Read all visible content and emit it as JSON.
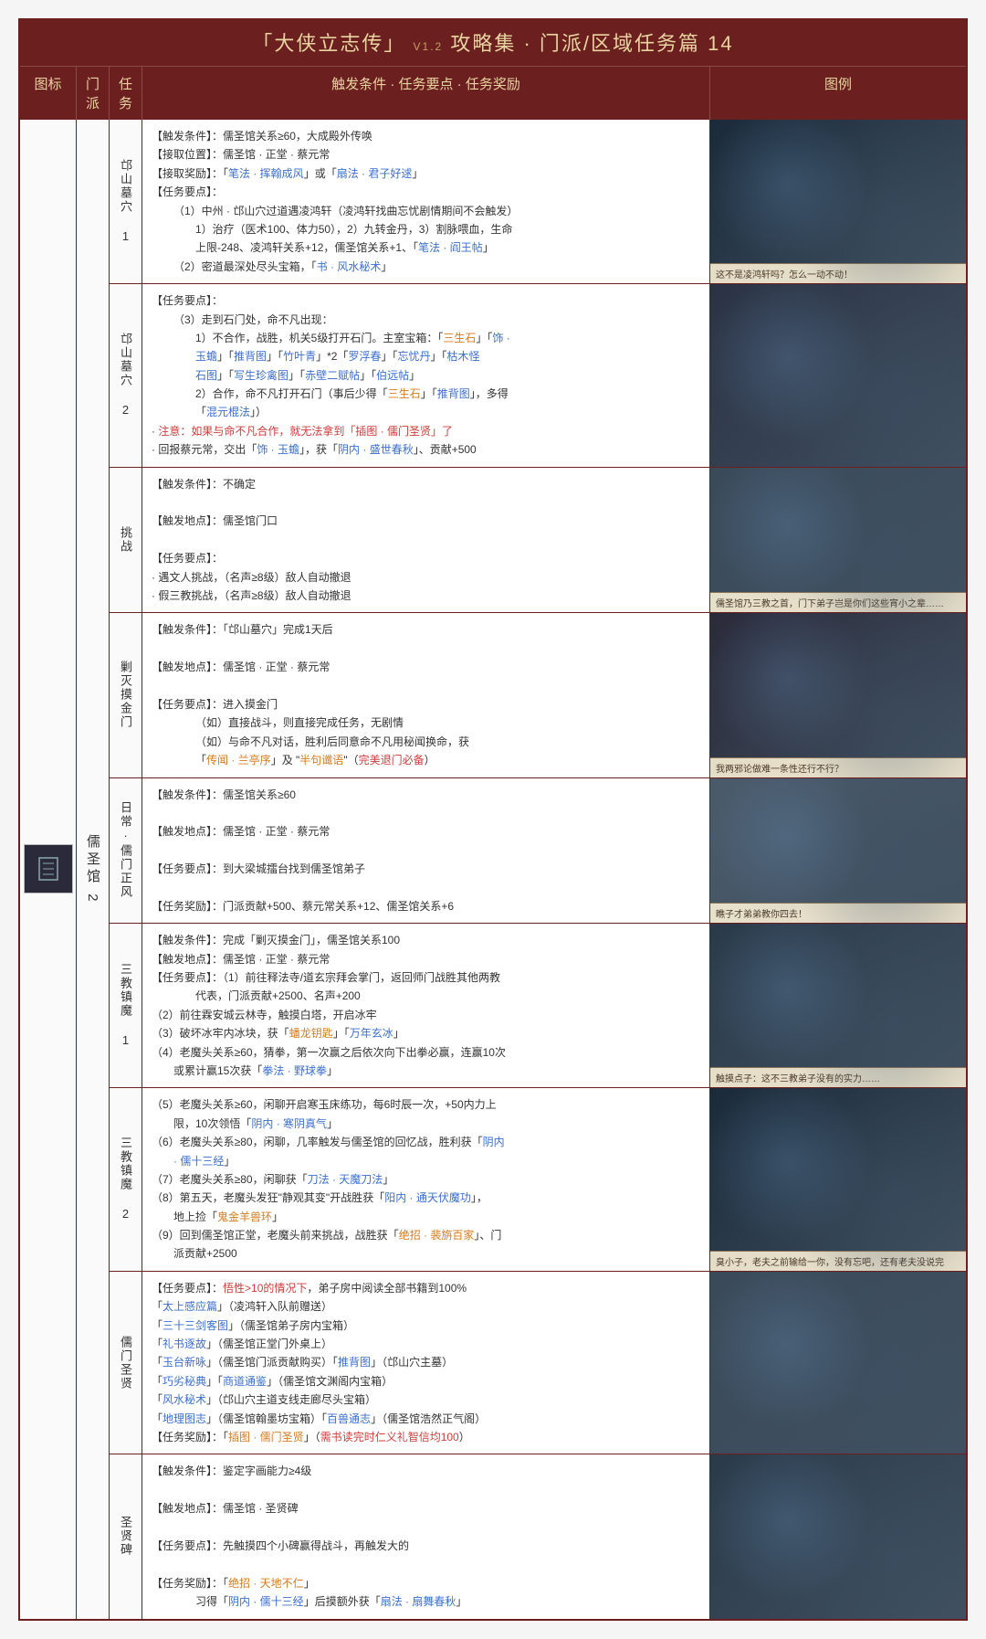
{
  "title_main": "「大侠立志传」",
  "title_ver": "V1.2",
  "title_sub": "攻略集 · 门派/区域任务篇 14",
  "headers": {
    "icon": "图标",
    "faction": "门派",
    "task": "任务",
    "detail": "触发条件 · 任务要点 · 任务奖励",
    "image": "图例"
  },
  "faction": "儒圣馆 2",
  "tasks": [
    {
      "name": "邙山墓穴 1",
      "caption": "这不是凌鸿轩吗？怎么一动不动！",
      "lines": [
        {
          "t": "【触发条件】：儒圣馆关系≥60，大成殿外传唤"
        },
        {
          "t": "【接取位置】：儒圣馆 · 正堂 · 蔡元常"
        },
        {
          "t": "【接取奖励】：「",
          "a": [
            {
              "c": "blue",
              "t": "笔法 · 挥翰成风"
            },
            {
              "t": "」或「"
            },
            {
              "c": "blue",
              "t": "扇法 · 君子好逑"
            },
            {
              "t": "」"
            }
          ]
        },
        {
          "t": "【任务要点】："
        },
        {
          "t": "（1）中州 · 邙山穴过道遇凌鸿轩（凌鸿轩找曲忘忧剧情期间不会触发）",
          "cls": "indent"
        },
        {
          "t": "1）治疗（医术100、体力50），2）九转金丹，3）割脉喂血，生命",
          "cls": "indent2"
        },
        {
          "t": "上限-248、凌鸿轩关系+12，儒圣馆关系+1、「",
          "cls": "indent2",
          "a": [
            {
              "c": "blue",
              "t": "笔法 · 阎王帖"
            },
            {
              "t": "」"
            }
          ]
        },
        {
          "t": "（2）密道最深处尽头宝箱，「",
          "cls": "indent",
          "a": [
            {
              "c": "blue",
              "t": "书 · 风水秘术"
            },
            {
              "t": "」"
            }
          ]
        }
      ]
    },
    {
      "name": "邙山墓穴 2",
      "caption": "",
      "lines": [
        {
          "t": "【任务要点】："
        },
        {
          "t": "（3）走到石门处，命不凡出现：",
          "cls": "indent"
        },
        {
          "t": "1）不合作，战胜，机关5级打开石门。主室宝箱：「",
          "cls": "indent2",
          "a": [
            {
              "c": "orange",
              "t": "三生石"
            },
            {
              "t": "」「"
            },
            {
              "c": "blue",
              "t": "饰 ·"
            }
          ]
        },
        {
          "cls": "indent2",
          "a": [
            {
              "c": "blue",
              "t": "玉蟾"
            },
            {
              "t": "」「"
            },
            {
              "c": "blue",
              "t": "推背图"
            },
            {
              "t": "」「"
            },
            {
              "c": "blue",
              "t": "竹叶青"
            },
            {
              "t": "」*2「"
            },
            {
              "c": "blue",
              "t": "罗浮春"
            },
            {
              "t": "」「"
            },
            {
              "c": "blue",
              "t": "忘忧丹"
            },
            {
              "t": "」「"
            },
            {
              "c": "blue",
              "t": "枯木怪"
            }
          ]
        },
        {
          "cls": "indent2",
          "a": [
            {
              "c": "blue",
              "t": "石图"
            },
            {
              "t": "」「"
            },
            {
              "c": "blue",
              "t": "写生珍禽图"
            },
            {
              "t": "」「"
            },
            {
              "c": "blue",
              "t": "赤壁二赋帖"
            },
            {
              "t": "」「"
            },
            {
              "c": "blue",
              "t": "伯远帖"
            },
            {
              "t": "」"
            }
          ]
        },
        {
          "t": "2）合作，命不凡打开石门（事后少得「",
          "cls": "indent2",
          "a": [
            {
              "c": "orange",
              "t": "三生石"
            },
            {
              "t": "」「"
            },
            {
              "c": "blue",
              "t": "推背图"
            },
            {
              "t": "」，多得"
            }
          ]
        },
        {
          "cls": "indent2",
          "a": [
            {
              "t": "「"
            },
            {
              "c": "blue",
              "t": "混元棍法"
            },
            {
              "t": "」）"
            }
          ]
        },
        {
          "a": [
            {
              "t": "· "
            },
            {
              "c": "red",
              "t": "注意：如果与命不凡合作，就无法拿到「插图 · 儒门圣贤」了"
            }
          ]
        },
        {
          "t": "· 回报蔡元常，交出「",
          "a": [
            {
              "c": "blue",
              "t": "饰 · 玉蟾"
            },
            {
              "t": "」，获「"
            },
            {
              "c": "blue",
              "t": "阴内 · 盛世春秋"
            },
            {
              "t": "」、贡献+500"
            }
          ]
        }
      ]
    },
    {
      "name": "挑战",
      "caption": "儒圣馆乃三教之首，门下弟子岂是你们这些宵小之辈……",
      "lines": [
        {
          "t": "【触发条件】：不确定"
        },
        {
          "t": ""
        },
        {
          "t": "【触发地点】：儒圣馆门口"
        },
        {
          "t": ""
        },
        {
          "t": "【任务要点】："
        },
        {
          "t": "· 遇文人挑战，（名声≥8级）敌人自动撤退"
        },
        {
          "t": "· 假三教挑战，（名声≥8级）敌人自动撤退"
        }
      ]
    },
    {
      "name": "剿灭摸金门",
      "caption": "我两邪论做难一条性还行不行？",
      "lines": [
        {
          "t": "【触发条件】：「邙山墓穴」完成1天后"
        },
        {
          "t": ""
        },
        {
          "t": "【触发地点】：儒圣馆 · 正堂 · 蔡元常"
        },
        {
          "t": ""
        },
        {
          "t": "【任务要点】：进入摸金门"
        },
        {
          "t": "（如）直接战斗，则直接完成任务，无剧情",
          "cls": "indent2"
        },
        {
          "t": "（如）与命不凡对话，胜利后同意命不凡用秘闻换命，获",
          "cls": "indent2"
        },
        {
          "cls": "indent2",
          "a": [
            {
              "t": "「"
            },
            {
              "c": "orange",
              "t": "传闻 · 兰亭序"
            },
            {
              "t": "」及 \""
            },
            {
              "c": "orange",
              "t": "半句谶语"
            },
            {
              "t": "\"（"
            },
            {
              "c": "red",
              "t": "完美退门必备"
            },
            {
              "t": "）"
            }
          ]
        }
      ]
    },
    {
      "name": "日常·儒门正风",
      "caption": "瞧子才弟弟教你四去！",
      "lines": [
        {
          "t": "【触发条件】：儒圣馆关系≥60"
        },
        {
          "t": ""
        },
        {
          "t": "【触发地点】：儒圣馆 · 正堂 · 蔡元常"
        },
        {
          "t": ""
        },
        {
          "t": "【任务要点】：到大梁城擂台找到儒圣馆弟子"
        },
        {
          "t": ""
        },
        {
          "t": "【任务奖励】：门派贡献+500、蔡元常关系+12、儒圣馆关系+6"
        }
      ]
    },
    {
      "name": "三教镇魔 1",
      "caption": "触摸点子：这不三教弟子没有的实力……",
      "lines": [
        {
          "t": "【触发条件】：完成「剿灭摸金门」，儒圣馆关系100"
        },
        {
          "t": "【触发地点】：儒圣馆 · 正堂 · 蔡元常"
        },
        {
          "t": "【任务要点】：（1）前往释法寺/道玄宗拜会掌门，返回师门战胜其他两教"
        },
        {
          "t": "代表，门派贡献+2500、名声+200",
          "cls": "indent2"
        },
        {
          "t": "（2）前往霖安城云林寺，触摸白塔，开启冰牢"
        },
        {
          "t": "（3）破坏冰牢内冰块，获「",
          "a": [
            {
              "c": "orange",
              "t": "蟠龙钥匙"
            },
            {
              "t": "」「"
            },
            {
              "c": "blue",
              "t": "万年玄冰"
            },
            {
              "t": "」"
            }
          ]
        },
        {
          "t": "（4）老魔头关系≥60，猜拳，第一次赢之后依次向下出拳必赢，连赢10次"
        },
        {
          "t": "或累计赢15次获「",
          "cls": "indent",
          "a": [
            {
              "c": "blue",
              "t": "拳法 · 野球拳"
            },
            {
              "t": "」"
            }
          ]
        }
      ]
    },
    {
      "name": "三教镇魔 2",
      "caption": "臭小子，老夫之前输给一你，没有忘吧，还有老夫没说完",
      "lines": [
        {
          "t": "（5）老魔头关系≥60，闲聊开启寒玉床练功，每6时辰一次，+50内力上"
        },
        {
          "t": "限，10次领悟「",
          "cls": "indent",
          "a": [
            {
              "c": "blue",
              "t": "阴内 · 寒阴真气"
            },
            {
              "t": "」"
            }
          ]
        },
        {
          "t": "（6）老魔头关系≥80，闲聊，几率触发与儒圣馆的回忆战，胜利获「",
          "a": [
            {
              "c": "blue",
              "t": "阴内"
            }
          ]
        },
        {
          "cls": "indent",
          "a": [
            {
              "c": "blue",
              "t": "· 儒十三经"
            },
            {
              "t": "」"
            }
          ]
        },
        {
          "t": "（7）老魔头关系≥80，闲聊获「",
          "a": [
            {
              "c": "blue",
              "t": "刀法 · 天魔刀法"
            },
            {
              "t": "」"
            }
          ]
        },
        {
          "t": "（8）第五天，老魔头发狂\"静观其变\"开战胜获「",
          "a": [
            {
              "c": "blue",
              "t": "阳内 · 通天伏魔功"
            },
            {
              "t": "」，"
            }
          ]
        },
        {
          "t": "地上捡「",
          "cls": "indent",
          "a": [
            {
              "c": "orange",
              "t": "鬼金羊兽环"
            },
            {
              "t": "」"
            }
          ]
        },
        {
          "t": "（9）回到儒圣馆正堂，老魔头前来挑战，战胜获「",
          "a": [
            {
              "c": "orange",
              "t": "绝招 · 裴旃百家"
            },
            {
              "t": "」、门"
            }
          ]
        },
        {
          "t": "派贡献+2500",
          "cls": "indent"
        }
      ]
    },
    {
      "name": "儒门圣贤",
      "caption": "",
      "lines": [
        {
          "t": "【任务要点】：",
          "a": [
            {
              "c": "red",
              "t": "悟性>10的情况下"
            },
            {
              "t": "，弟子房中阅读全部书籍到100%"
            }
          ]
        },
        {
          "a": [
            {
              "t": "「"
            },
            {
              "c": "blue",
              "t": "太上感应篇"
            },
            {
              "t": "」（凌鸿轩入队前赠送）"
            }
          ]
        },
        {
          "a": [
            {
              "t": "「"
            },
            {
              "c": "blue",
              "t": "三十三剑客图"
            },
            {
              "t": "」（儒圣馆弟子房内宝箱）"
            }
          ]
        },
        {
          "a": [
            {
              "t": "「"
            },
            {
              "c": "blue",
              "t": "礼书逐故"
            },
            {
              "t": "」（儒圣馆正堂门外桌上）"
            }
          ]
        },
        {
          "a": [
            {
              "t": "「"
            },
            {
              "c": "blue",
              "t": "玉台新咏"
            },
            {
              "t": "」（儒圣馆门派贡献购买）「"
            },
            {
              "c": "blue",
              "t": "推背图"
            },
            {
              "t": "」（邙山穴主墓）"
            }
          ]
        },
        {
          "a": [
            {
              "t": "「"
            },
            {
              "c": "blue",
              "t": "巧劣秘典"
            },
            {
              "t": "」「"
            },
            {
              "c": "blue",
              "t": "商道通鉴"
            },
            {
              "t": "」（儒圣馆文渊阁内宝箱）"
            }
          ]
        },
        {
          "a": [
            {
              "t": "「"
            },
            {
              "c": "blue",
              "t": "风水秘术"
            },
            {
              "t": "」（邙山穴主道支线走廊尽头宝箱）"
            }
          ]
        },
        {
          "a": [
            {
              "t": "「"
            },
            {
              "c": "blue",
              "t": "地理图志"
            },
            {
              "t": "」（儒圣馆翰墨坊宝箱）「"
            },
            {
              "c": "blue",
              "t": "百兽通志"
            },
            {
              "t": "」（儒圣馆浩然正气阁）"
            }
          ]
        },
        {
          "t": "【任务奖励】：「",
          "a": [
            {
              "c": "orange",
              "t": "插图 · 儒门圣贤"
            },
            {
              "t": "」（"
            },
            {
              "c": "red",
              "t": "需书读完时仁义礼智信均100"
            },
            {
              "t": "）"
            }
          ]
        }
      ]
    },
    {
      "name": "圣贤碑",
      "caption": "",
      "lines": [
        {
          "t": "【触发条件】：鉴定字画能力≥4级"
        },
        {
          "t": ""
        },
        {
          "t": "【触发地点】：儒圣馆 · 圣贤碑"
        },
        {
          "t": ""
        },
        {
          "t": "【任务要点】：先触摸四个小碑赢得战斗，再触发大的"
        },
        {
          "t": ""
        },
        {
          "t": "【任务奖励】：「",
          "a": [
            {
              "c": "orange",
              "t": "绝招 · 天地不仁"
            },
            {
              "t": "」"
            }
          ]
        },
        {
          "t": "习得「",
          "cls": "indent2",
          "a": [
            {
              "c": "blue",
              "t": "阴内 · 儒十三经"
            },
            {
              "t": "」后摸额外获「"
            },
            {
              "c": "blue",
              "t": "扇法 · 扇舞春秋"
            },
            {
              "t": "」"
            }
          ]
        }
      ]
    }
  ]
}
